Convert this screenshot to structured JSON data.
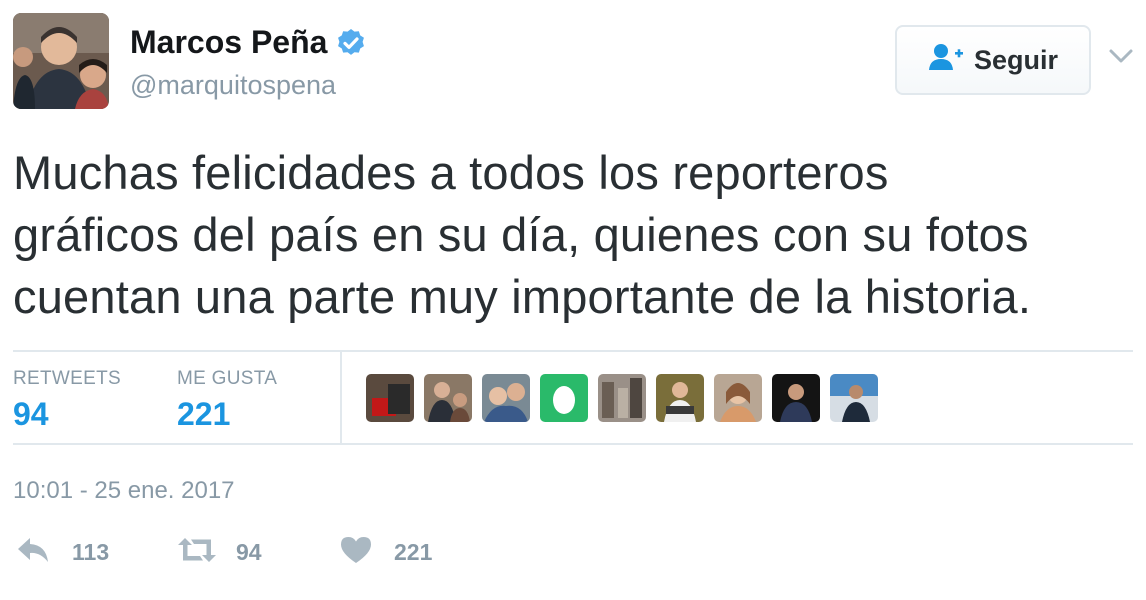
{
  "author": {
    "name": "Marcos Peña",
    "handle": "@marquitospena",
    "verified_icon": "verified-badge-icon",
    "verified_color": "#55acee"
  },
  "follow_button": {
    "label": "Seguir",
    "icon": "add-user-icon"
  },
  "tweet": {
    "lines": [
      "Muchas felicidades a todos los reporteros",
      "gráficos del país en su día, quienes con su fotos",
      "cuentan una parte muy importante de la historia."
    ]
  },
  "stats": {
    "retweets_label": "RETWEETS",
    "retweets_value": "94",
    "likes_label": "ME GUSTA",
    "likes_value": "221"
  },
  "timestamp": "10:01 - 25 ene. 2017",
  "actions": {
    "reply_count": "113",
    "retweet_count": "94",
    "like_count": "221"
  },
  "colors": {
    "accent": "#1b95e0",
    "muted": "#8899a6",
    "text": "#292f33",
    "divider": "#e1e8ed"
  }
}
